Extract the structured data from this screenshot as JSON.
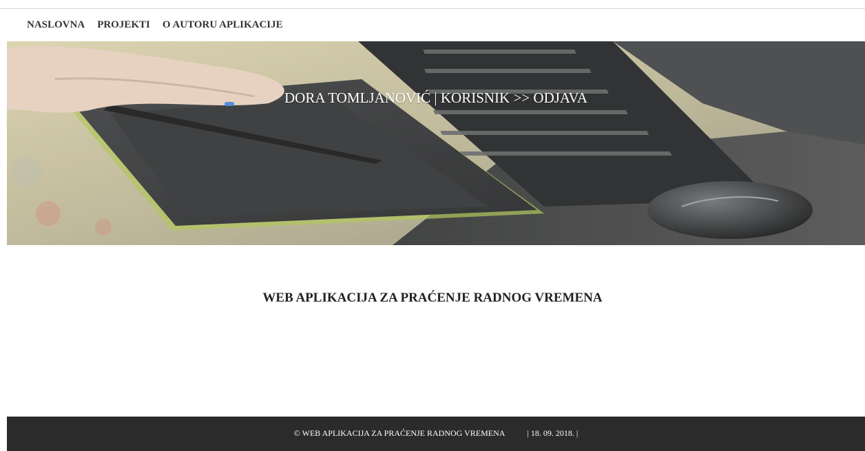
{
  "nav": {
    "items": [
      "NASLOVNA",
      "PROJEKTI",
      "O AUTORU APLIKACIJE"
    ]
  },
  "hero": {
    "user_name": "DORA TOMLJANOVIĆ",
    "separator": " | ",
    "role": "KORISNIK",
    "arrow": " >> ",
    "logout": "ODJAVA"
  },
  "main": {
    "title": "WEB APLIKACIJA ZA PRAĆENJE RADNOG VREMENA"
  },
  "footer": {
    "copyright": "© WEB APLIKACIJA ZA PRAĆENJE RADNOG VREMENA",
    "date": "| 18. 09. 2018. |"
  }
}
